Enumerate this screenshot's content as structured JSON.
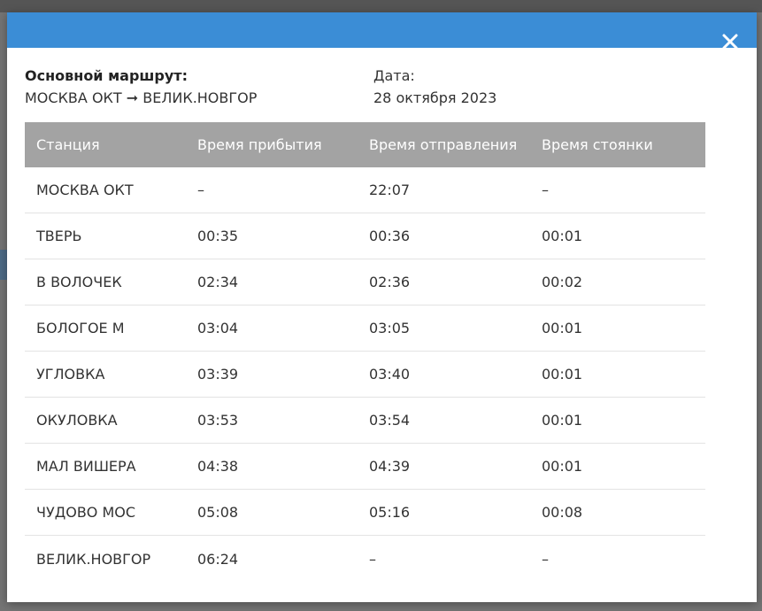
{
  "modal": {
    "route_label": "Основной маршрут:",
    "route_value": "МОСКВА ОКТ ➞ ВЕЛИК.НОВГОР",
    "date_label": "Дата:",
    "date_value": "28 октября 2023",
    "close_icon": "close-icon",
    "header_color": "#3b8dd6"
  },
  "table": {
    "columns": [
      "Станция",
      "Время прибытия",
      "Время отправления",
      "Время стоянки"
    ],
    "rows": [
      [
        "МОСКВА ОКТ",
        "–",
        "22:07",
        "–"
      ],
      [
        "ТВЕРЬ",
        "00:35",
        "00:36",
        "00:01"
      ],
      [
        "В ВОЛОЧЕК",
        "02:34",
        "02:36",
        "00:02"
      ],
      [
        "БОЛОГОЕ М",
        "03:04",
        "03:05",
        "00:01"
      ],
      [
        "УГЛОВКА",
        "03:39",
        "03:40",
        "00:01"
      ],
      [
        "ОКУЛОВКА",
        "03:53",
        "03:54",
        "00:01"
      ],
      [
        "МАЛ ВИШЕРА",
        "04:38",
        "04:39",
        "00:01"
      ],
      [
        "ЧУДОВО МОС",
        "05:08",
        "05:16",
        "00:08"
      ],
      [
        "ВЕЛИК.НОВГОР",
        "06:24",
        "–",
        "–"
      ]
    ]
  }
}
